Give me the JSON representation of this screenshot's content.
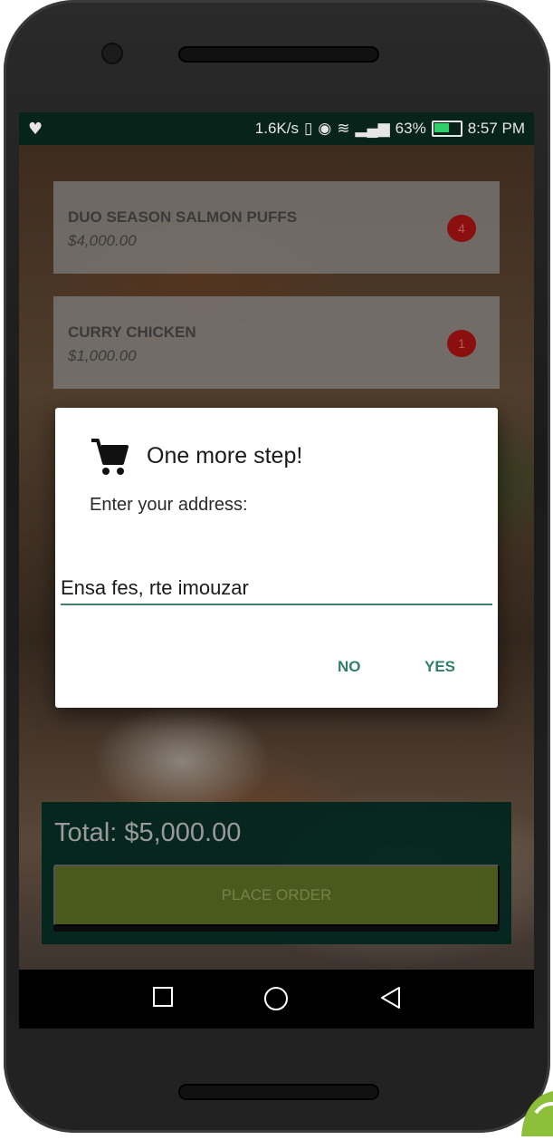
{
  "status_bar": {
    "left_icon": "heart-pulse-icon",
    "net_speed": "1.6K/s",
    "battery_percent": "63%",
    "battery_level": 0.63,
    "time": "8:57 PM",
    "icons": [
      "vibrate-icon",
      "eye-icon",
      "wifi-icon",
      "signal-icon",
      "battery-icon"
    ]
  },
  "cart": {
    "items": [
      {
        "name": "DUO SEASON SALMON PUFFS",
        "price": "$4,000.00",
        "quantity": "4"
      },
      {
        "name": "CURRY CHICKEN",
        "price": "$1,000.00",
        "quantity": "1"
      }
    ]
  },
  "total": {
    "label": "Total:",
    "amount": "$5,000.00"
  },
  "place_order_label": "PLACE ORDER",
  "dialog": {
    "icon": "shopping-cart-icon",
    "title": "One more step!",
    "message": "Enter your address:",
    "address_value": "Ensa fes, rte imouzar",
    "no_label": "NO",
    "yes_label": "YES"
  },
  "navbar": {
    "icons": [
      "recents-square-icon",
      "home-circle-icon",
      "back-triangle-icon"
    ]
  },
  "colors": {
    "accent": "#2f7f6a",
    "status_bar_bg": "#08231a",
    "badge": "#8b0f0f",
    "button_olive": "#4a5a1e"
  }
}
